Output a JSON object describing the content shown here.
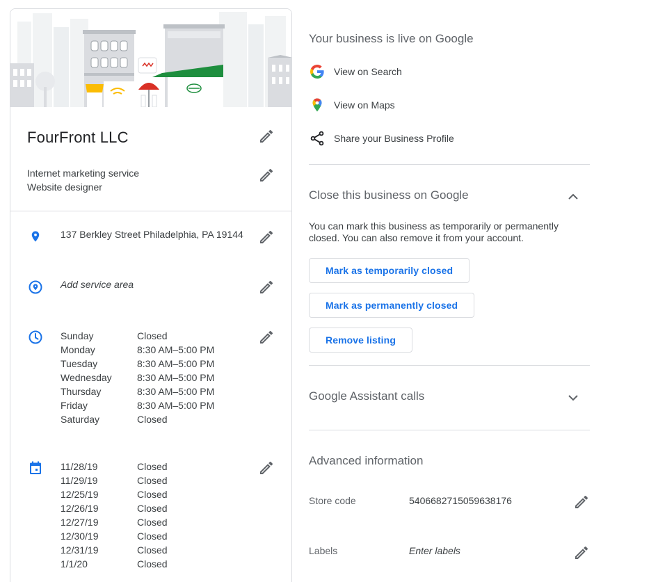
{
  "business": {
    "name": "FourFront LLC",
    "categories": [
      "Internet marketing service",
      "Website designer"
    ],
    "address": "137 Berkley Street Philadelphia, PA 19144",
    "service_area_placeholder": "Add service area",
    "hours": [
      {
        "day": "Sunday",
        "time": "Closed"
      },
      {
        "day": "Monday",
        "time": "8:30 AM–5:00 PM"
      },
      {
        "day": "Tuesday",
        "time": "8:30 AM–5:00 PM"
      },
      {
        "day": "Wednesday",
        "time": "8:30 AM–5:00 PM"
      },
      {
        "day": "Thursday",
        "time": "8:30 AM–5:00 PM"
      },
      {
        "day": "Friday",
        "time": "8:30 AM–5:00 PM"
      },
      {
        "day": "Saturday",
        "time": "Closed"
      }
    ],
    "special_hours": [
      {
        "date": "11/28/19",
        "time": "Closed"
      },
      {
        "date": "11/29/19",
        "time": "Closed"
      },
      {
        "date": "12/25/19",
        "time": "Closed"
      },
      {
        "date": "12/26/19",
        "time": "Closed"
      },
      {
        "date": "12/27/19",
        "time": "Closed"
      },
      {
        "date": "12/30/19",
        "time": "Closed"
      },
      {
        "date": "12/31/19",
        "time": "Closed"
      },
      {
        "date": "1/1/20",
        "time": "Closed"
      }
    ]
  },
  "live": {
    "title": "Your business is live on Google",
    "links": [
      {
        "label": "View on Search",
        "icon": "google-g-icon"
      },
      {
        "label": "View on Maps",
        "icon": "maps-pin-icon"
      },
      {
        "label": "Share your Business Profile",
        "icon": "share-icon"
      }
    ]
  },
  "close_section": {
    "title": "Close this business on Google",
    "description": "You can mark this business as temporarily or permanently closed. You can also remove it from your account.",
    "buttons": {
      "temporarily": "Mark as temporarily closed",
      "permanently": "Mark as permanently closed",
      "remove": "Remove listing"
    }
  },
  "assistant_section": {
    "title": "Google Assistant calls"
  },
  "advanced": {
    "title": "Advanced information",
    "store_code_label": "Store code",
    "store_code_value": "5406682715059638176",
    "labels_label": "Labels",
    "labels_placeholder": "Enter labels"
  },
  "colors": {
    "accent_blue": "#1a73e8",
    "icon_blue": "#1a73e8",
    "text_secondary": "#5f6368",
    "divider": "#dadce0",
    "awning_green": "#1e8e3e",
    "awning_red": "#d93025",
    "awning_yellow": "#fbbc04"
  }
}
